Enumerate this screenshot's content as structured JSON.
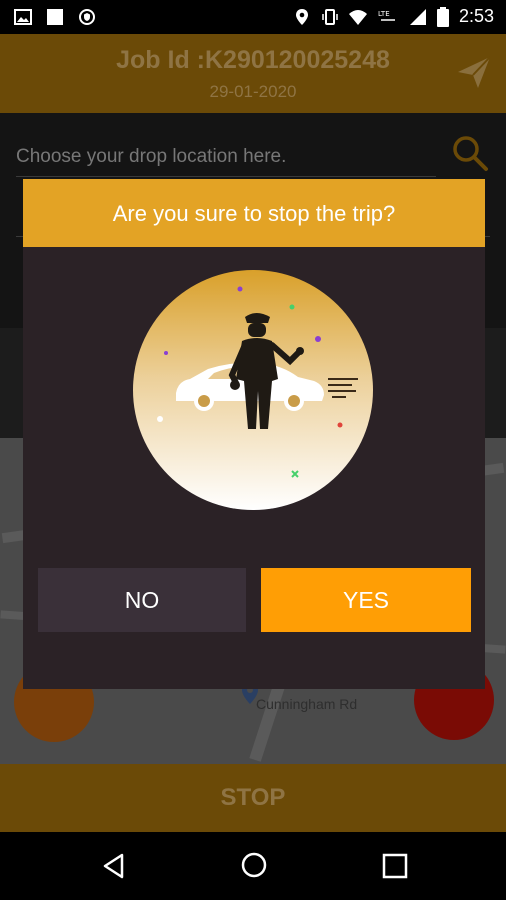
{
  "status_bar": {
    "time": "2:53",
    "icons_left": [
      "image-icon",
      "square-notification-icon",
      "shield-icon"
    ],
    "icons_right": [
      "location-icon",
      "vibrate-icon",
      "wifi-icon",
      "lte-icon",
      "signal-icon",
      "battery-icon"
    ]
  },
  "header": {
    "job_title": "Job Id :K290120025248",
    "date": "29-01-2020"
  },
  "search": {
    "placeholder": "Choose your drop location here."
  },
  "map": {
    "street_label": "Cunningham Rd"
  },
  "stop_button": "STOP",
  "dialog": {
    "title": "Are you sure to stop the trip?",
    "no_label": "NO",
    "yes_label": "YES"
  },
  "colors": {
    "header_gold": "#e3a325",
    "yes_orange": "#ff9e05",
    "dialog_bg": "#2b2226",
    "no_bg": "#3a3039"
  }
}
